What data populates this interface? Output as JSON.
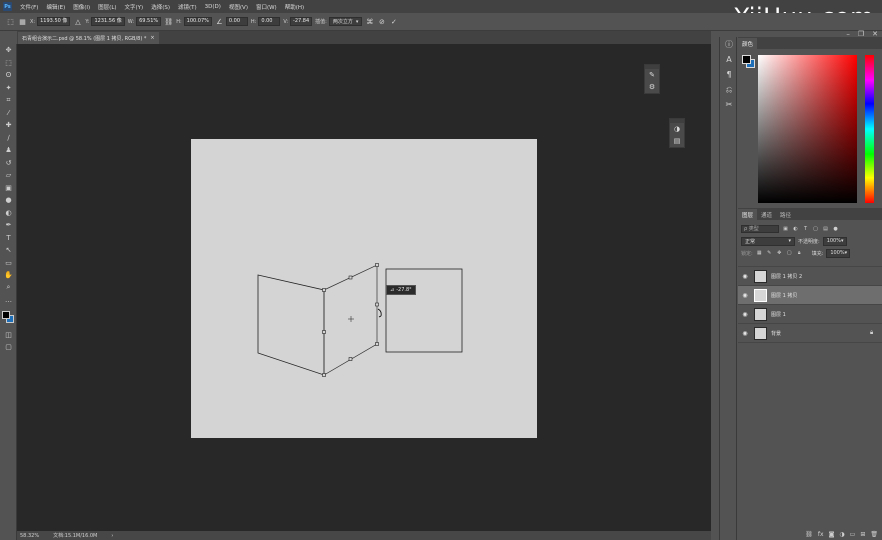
{
  "watermark": "YiiHuu.com",
  "menu": {
    "logo": "Ps",
    "items": [
      "文件(F)",
      "编辑(E)",
      "图像(I)",
      "图层(L)",
      "文字(Y)",
      "选择(S)",
      "滤镜(T)",
      "3D(D)",
      "视图(V)",
      "窗口(W)",
      "帮助(H)"
    ]
  },
  "window_controls": [
    "–",
    "❐",
    "✕"
  ],
  "options": {
    "x_label": "X:",
    "x_value": "1193.50 像",
    "y_label": "Y:",
    "y_value": "1231.56 像",
    "w_label": "W:",
    "w_value": "69.51%",
    "h_label": "H:",
    "h_value": "100.07%",
    "angle_value": "0.00",
    "hskew_label": "H:",
    "hskew_value": "0.00",
    "vskew_label": "V:",
    "vskew_value": "-27.84",
    "interp_label": "插值:",
    "interp_value": "两次立方"
  },
  "document_tab": {
    "title": "石青组合演示二.psd @ 58.1% (图层 1 拷贝, RGB/8) *",
    "close": "×"
  },
  "tools": [
    "move-icon",
    "marquee-icon",
    "lasso-icon",
    "magic-wand-icon",
    "crop-icon",
    "eyedropper-icon",
    "healing-icon",
    "brush-icon",
    "stamp-icon",
    "history-brush-icon",
    "eraser-icon",
    "gradient-icon",
    "blur-icon",
    "dodge-icon",
    "pen-icon",
    "type-icon",
    "path-select-icon",
    "rectangle-icon",
    "hand-icon",
    "zoom-icon",
    "more-icon"
  ],
  "tooltip": {
    "icon": "⊿",
    "value": "-27.8°"
  },
  "status": {
    "zoom": "58.32%",
    "doc": "文档:15.1M/16.0M",
    "arrow": "›"
  },
  "color_panel": {
    "tab": "颜色",
    "foreground": "#000000",
    "background": "#1e6fb8"
  },
  "layers_panel": {
    "tabs": [
      "图层",
      "通道",
      "路径"
    ],
    "search_placeholder": "ρ 类型",
    "blend_mode": "正常",
    "opacity_label": "不透明度:",
    "opacity_value": "100%",
    "lock_label": "锁定:",
    "fill_label": "填充:",
    "fill_value": "100%",
    "layers": [
      {
        "name": "图层 1 拷贝 2",
        "selected": false,
        "locked": false
      },
      {
        "name": "图层 1 拷贝",
        "selected": true,
        "locked": false
      },
      {
        "name": "图层 1",
        "selected": false,
        "locked": false
      },
      {
        "name": "背景",
        "selected": false,
        "locked": true
      }
    ]
  },
  "colors": {
    "accent": "#1e6fb8",
    "canvas": "#d4d4d4",
    "workspace": "#282828"
  }
}
